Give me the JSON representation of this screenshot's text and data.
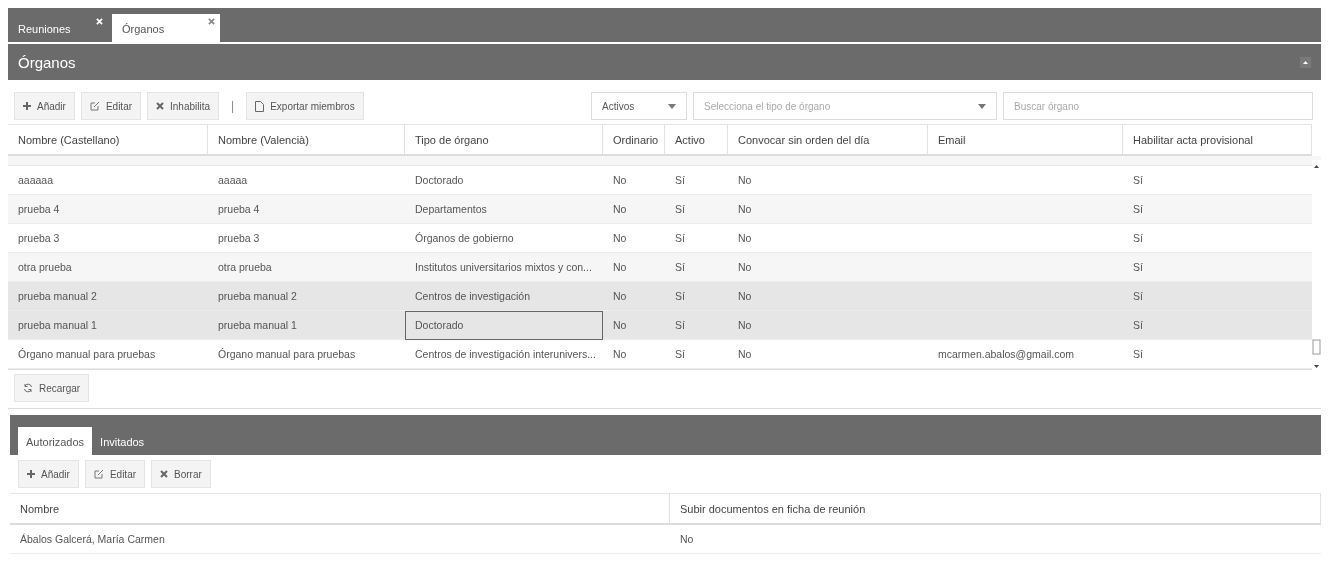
{
  "tabs": [
    {
      "label": "Reuniones",
      "selected": false
    },
    {
      "label": "Órganos",
      "selected": true
    }
  ],
  "panel": {
    "title": "Órganos",
    "collapsed": false
  },
  "toolbar": {
    "buttons": [
      {
        "kind": "add",
        "label": "Añadir"
      },
      {
        "kind": "edit",
        "label": "Editar"
      },
      {
        "kind": "remove",
        "label": "Inhabilita"
      },
      {
        "kind": "separator",
        "label": "|"
      },
      {
        "kind": "export",
        "label": "Exportar miembros"
      }
    ],
    "status_filter": {
      "value": "Activos"
    },
    "type_filter": {
      "placeholder": "Selecciona el tipo de órgano"
    },
    "search": {
      "placeholder": "Buscar órgano"
    }
  },
  "table": {
    "columns": [
      "Nombre (Castellano)",
      "Nombre (Valencià)",
      "Tipo de órgano",
      "Ordinario",
      "Activo",
      "Convocar sin orden del día",
      "Email",
      "Habilitar acta provisional"
    ],
    "rows": [
      {
        "selected": false,
        "cells": [
          "aaaaaa",
          "aaaaa",
          "Doctorado",
          "No",
          "Sí",
          "No",
          null,
          "Sí"
        ]
      },
      {
        "selected": false,
        "cells": [
          "prueba 4",
          "prueba 4",
          "Departamentos",
          "No",
          "Sí",
          "No",
          null,
          "Sí"
        ]
      },
      {
        "selected": false,
        "cells": [
          "prueba 3",
          "prueba 3",
          "Órganos de gobierno",
          "No",
          "Sí",
          "No",
          null,
          "Sí"
        ]
      },
      {
        "selected": false,
        "cells": [
          "otra prueba",
          "otra prueba",
          "Institutos universitarios mixtos y con...",
          "No",
          "Sí",
          "No",
          null,
          "Sí"
        ]
      },
      {
        "selected": true,
        "cells": [
          "prueba manual 2",
          "prueba manual 2",
          "Centros de investigación",
          "No",
          "Sí",
          "No",
          null,
          "Sí"
        ]
      },
      {
        "selected": true,
        "cells": [
          "prueba manual 1",
          "prueba manual 1",
          {
            "text": "Doctorado",
            "focused": true
          },
          "No",
          "Sí",
          "No",
          null,
          "Sí"
        ]
      },
      {
        "selected": false,
        "cells": [
          "Órgano manual para pruebas",
          "Órgano manual para pruebas",
          "Centros de investigación interunivers...",
          "No",
          "Sí",
          "No",
          "mcarmen.abalos@gmail.com",
          "Sí"
        ]
      }
    ],
    "reload_button": "Recargar"
  },
  "sub_tabs": [
    {
      "label": "Autorizados",
      "selected": true
    },
    {
      "label": "Invitados",
      "selected": false
    }
  ],
  "sub_toolbar": [
    {
      "kind": "add",
      "label": "Añadir"
    },
    {
      "kind": "edit",
      "label": "Editar"
    },
    {
      "kind": "remove",
      "label": "Borrar"
    }
  ],
  "sub_table": {
    "columns": [
      "Nombre",
      "Subir documentos en ficha de reunión"
    ],
    "rows": [
      {
        "cells": [
          "Ábalos Galcerá, María Carmen",
          "No"
        ]
      }
    ]
  }
}
